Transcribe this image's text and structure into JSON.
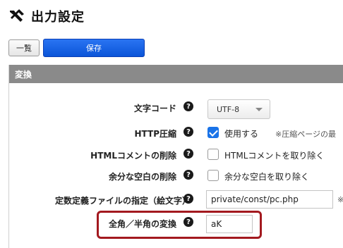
{
  "page": {
    "title": "出力設定",
    "icon": "tools-icon"
  },
  "toolbar": {
    "list_label": "一覧",
    "save_label": "保存"
  },
  "section": {
    "title": "変換"
  },
  "settings": {
    "charset": {
      "label": "文字コード",
      "value": "UTF-8"
    },
    "gzip": {
      "label": "HTTP圧縮",
      "checkbox_label": "使用する",
      "checked": true,
      "note": "※圧縮ページの最"
    },
    "html_comment": {
      "label": "HTMLコメントの削除",
      "checkbox_label": "HTMLコメントを取り除く",
      "checked": false
    },
    "whitespace": {
      "label": "余分な空白の削除",
      "checkbox_label": "余分な空白を取り除く",
      "checked": false
    },
    "const_file": {
      "label": "定数定義ファイルの指定（絵文字）",
      "value": "private/const/pc.php",
      "note": "※"
    },
    "kana_convert": {
      "label": "全角／半角の変換",
      "value": "aK"
    }
  },
  "help_symbol": "?",
  "colors": {
    "accent_blue": "#1a73e8",
    "highlight_red": "#a3191f",
    "section_header": "#8a8a8a"
  }
}
